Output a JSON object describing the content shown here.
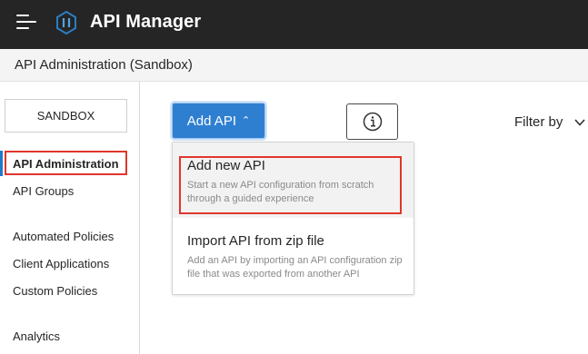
{
  "header": {
    "app_title": "API Manager",
    "menu_icon": "hamburger-menu-icon",
    "logo_icon": "api-manager-logo-icon",
    "background_color": "#252525"
  },
  "subheader": {
    "breadcrumb": "API Administration (Sandbox)"
  },
  "sidebar": {
    "environment_label": "SANDBOX",
    "items": [
      {
        "label": "API Administration",
        "active": true
      },
      {
        "label": "API Groups"
      },
      {
        "label": "Automated Policies"
      },
      {
        "label": "Client Applications"
      },
      {
        "label": "Custom Policies"
      },
      {
        "label": "Analytics"
      }
    ],
    "accent_color": "#1f7acc"
  },
  "toolbar": {
    "add_api_label": "Add API",
    "add_api_chevron": "chevron-up-icon",
    "add_api_color": "#2f7fd1",
    "info_icon": "info-icon",
    "filter_label": "Filter by",
    "filter_chevron": "chevron-down-icon"
  },
  "dropdown": {
    "items": [
      {
        "title": "Add new API",
        "description": "Start a new API configuration from scratch through a guided experience"
      },
      {
        "title": "Import API from zip file",
        "description": "Add an API by importing an API configuration zip file that was exported from another API"
      }
    ]
  },
  "highlight_color": "#e0362c"
}
